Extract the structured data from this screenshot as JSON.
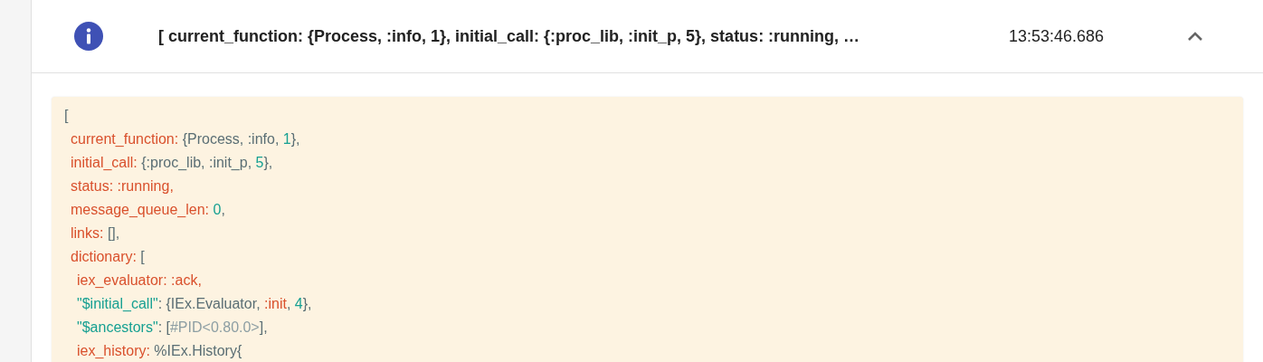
{
  "log_entry": {
    "summary": "[ current_function: {Process, :info, 1}, initial_call: {:proc_lib, :init_p, 5}, status: :running, …",
    "time": "13:53:46.686",
    "expanded": true,
    "code_lines": [
      {
        "segments": [
          {
            "kind": "punct",
            "text": "["
          }
        ],
        "children": [
          {
            "segments": [
              {
                "kind": "key",
                "text": "current_function:"
              },
              {
                "kind": "punct",
                "text": " {Process, :info, "
              },
              {
                "kind": "number",
                "text": "1"
              },
              {
                "kind": "punct",
                "text": "},"
              }
            ]
          },
          {
            "segments": [
              {
                "kind": "key",
                "text": "initial_call:"
              },
              {
                "kind": "punct",
                "text": " {:proc_lib, :init_p, "
              },
              {
                "kind": "number",
                "text": "5"
              },
              {
                "kind": "punct",
                "text": "},"
              }
            ]
          },
          {
            "segments": [
              {
                "kind": "key",
                "text": "status: :running,"
              }
            ]
          },
          {
            "segments": [
              {
                "kind": "key",
                "text": "message_queue_len:"
              },
              {
                "kind": "number",
                "text": "0",
                "space_before": true
              },
              {
                "kind": "punct",
                "text": ","
              }
            ]
          },
          {
            "segments": [
              {
                "kind": "key",
                "text": "links:"
              },
              {
                "kind": "punct",
                "text": " [],"
              }
            ]
          },
          {
            "segments": [
              {
                "kind": "key",
                "text": "dictionary:"
              },
              {
                "kind": "punct",
                "text": " ["
              }
            ],
            "children": [
              {
                "segments": [
                  {
                    "kind": "key",
                    "text": "iex_evaluator: :ack,"
                  }
                ]
              },
              {
                "segments": [
                  {
                    "kind": "string",
                    "text": "\"$initial_call\""
                  },
                  {
                    "kind": "punct",
                    "text": ": {IEx.Evaluator, "
                  },
                  {
                    "kind": "key",
                    "text": ":init"
                  },
                  {
                    "kind": "punct",
                    "text": ", "
                  },
                  {
                    "kind": "number",
                    "text": "4"
                  },
                  {
                    "kind": "punct",
                    "text": "},"
                  }
                ]
              },
              {
                "segments": [
                  {
                    "kind": "string",
                    "text": "\"$ancestors\""
                  },
                  {
                    "kind": "punct",
                    "text": ": ["
                  },
                  {
                    "kind": "pid",
                    "text": "#PID<0.80.0>"
                  },
                  {
                    "kind": "punct",
                    "text": "],"
                  }
                ]
              },
              {
                "segments": [
                  {
                    "kind": "key",
                    "text": "iex_history:"
                  },
                  {
                    "kind": "punct",
                    "text": " %IEx.History{"
                  }
                ]
              }
            ]
          }
        ]
      }
    ]
  }
}
